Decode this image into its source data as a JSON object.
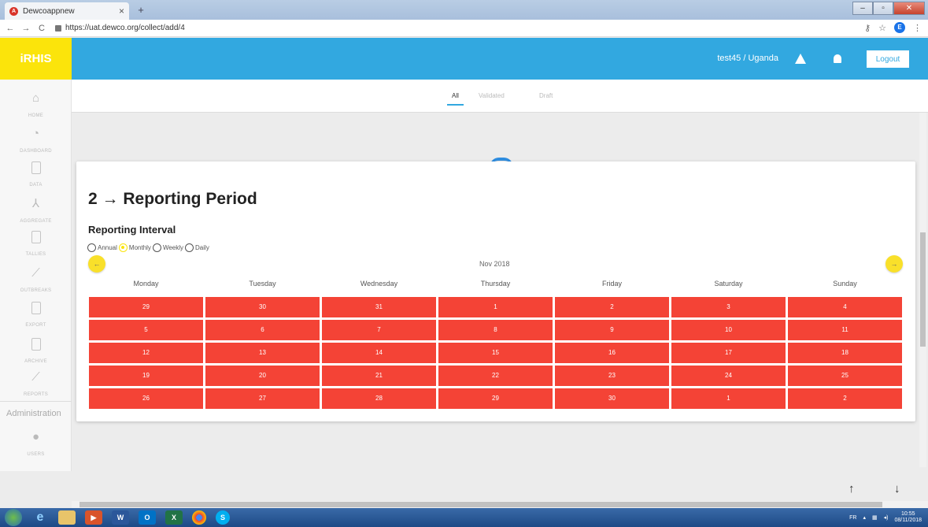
{
  "browser": {
    "tab_title": "Dewcoappnew",
    "tab_close": "×",
    "new_tab": "+",
    "url": "https://uat.dewco.org/collect/add/4"
  },
  "app": {
    "logo": "iRHIS",
    "user": "test45 / Uganda",
    "logout": "Logout"
  },
  "sidebar": {
    "items": [
      {
        "label": "HOME",
        "icon": "home-icon"
      },
      {
        "label": "DASHBOARD",
        "icon": "dashboard-icon"
      },
      {
        "label": "DATA",
        "icon": "document-icon"
      },
      {
        "label": "AGGREGATE",
        "icon": "aggregate-icon"
      },
      {
        "label": "TALLIES",
        "icon": "document-icon"
      },
      {
        "label": "OUTBREAKS",
        "icon": "chart-icon"
      },
      {
        "label": "EXPORT",
        "icon": "document-icon"
      },
      {
        "label": "ARCHIVE",
        "icon": "document-icon"
      },
      {
        "label": "REPORTS",
        "icon": "chart-icon"
      }
    ],
    "admin_heading": "Administration",
    "admin_items": [
      {
        "label": "USERS",
        "icon": "user-icon"
      }
    ]
  },
  "page_tabs": [
    "All",
    "Validated",
    "Draft"
  ],
  "section": {
    "title": "2 → Reporting Period",
    "subtitle": "Reporting Interval",
    "intervals": [
      "Annual",
      "Monthly",
      "Weekly",
      "Daily"
    ],
    "selected_interval": "Monthly",
    "prev": "←",
    "next": "→",
    "month": "Nov 2018",
    "weekdays": [
      "Monday",
      "Tuesday",
      "Wednesday",
      "Thursday",
      "Friday",
      "Saturday",
      "Sunday"
    ],
    "weeks": [
      [
        "29",
        "30",
        "31",
        "1",
        "2",
        "3",
        "4"
      ],
      [
        "5",
        "6",
        "7",
        "8",
        "9",
        "10",
        "11"
      ],
      [
        "12",
        "13",
        "14",
        "15",
        "16",
        "17",
        "18"
      ],
      [
        "19",
        "20",
        "21",
        "22",
        "23",
        "24",
        "25"
      ],
      [
        "26",
        "27",
        "28",
        "29",
        "30",
        "1",
        "2"
      ]
    ]
  },
  "scroll": {
    "up": "↑",
    "down": "↓"
  },
  "taskbar": {
    "lang": "FR",
    "time": "10:55",
    "date": "08/11/2018"
  },
  "colors": {
    "accent": "#32a8e0",
    "logo_bg": "#fbe40b",
    "cell_bg": "#f44336"
  }
}
